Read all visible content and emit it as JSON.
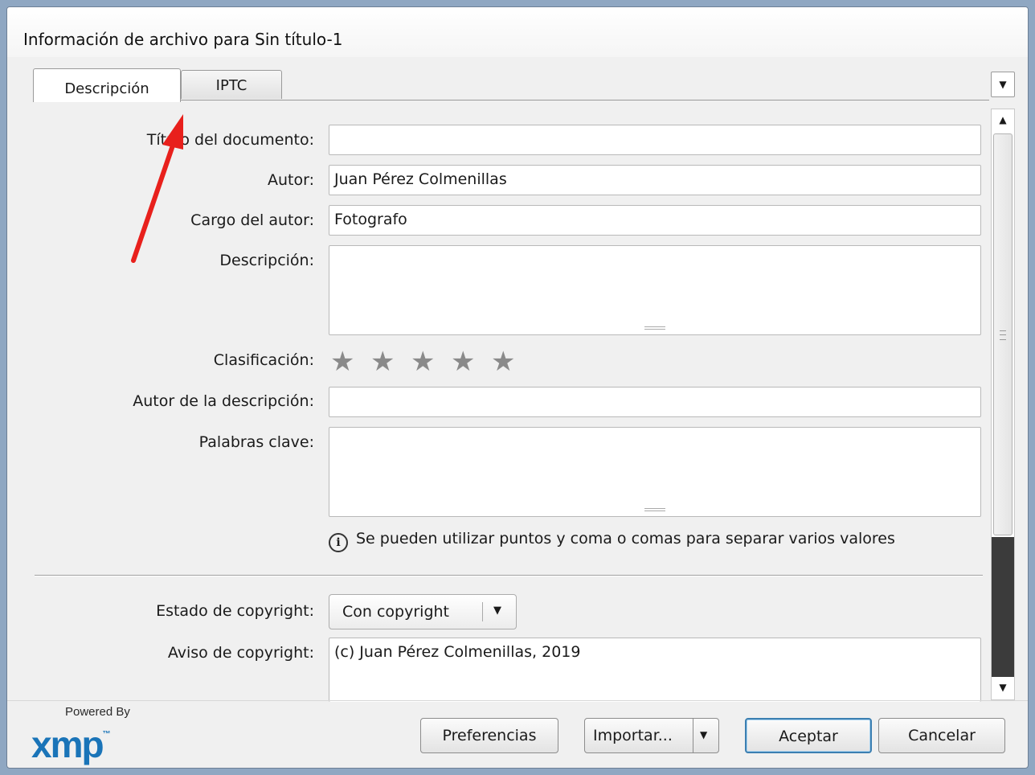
{
  "window": {
    "title": "Información de archivo para Sin título-1"
  },
  "tabs": [
    {
      "label": "Descripción",
      "active": true
    },
    {
      "label": "IPTC",
      "active": false
    }
  ],
  "menu_arrow": "chevron-down-icon",
  "form": {
    "doc_title": {
      "label": "Título del documento:",
      "value": ""
    },
    "author": {
      "label": "Autor:",
      "value": "Juan Pérez Colmenillas"
    },
    "author_title": {
      "label": "Cargo del autor:",
      "value": "Fotografo"
    },
    "description": {
      "label": "Descripción:",
      "value": ""
    },
    "rating": {
      "label": "Clasificación:",
      "stars_total": 5,
      "stars_filled": 0
    },
    "description_writer": {
      "label": "Autor de la descripción:",
      "value": ""
    },
    "keywords": {
      "label": "Palabras clave:",
      "value": ""
    },
    "keywords_hint": "Se pueden utilizar puntos y coma o comas para separar varios valores",
    "copyright_status": {
      "label": "Estado de copyright:",
      "selected": "Con copyright"
    },
    "copyright_notice": {
      "label": "Aviso de copyright:",
      "value": "(c) Juan Pérez Colmenillas, 2019"
    }
  },
  "footer": {
    "logo_powered": "Powered By",
    "logo_mark": "xmp",
    "logo_tm": "™",
    "buttons": {
      "preferences": "Preferencias",
      "import": "Importar...",
      "accept": "Aceptar",
      "cancel": "Cancelar"
    }
  },
  "colors": {
    "annotation_arrow": "#e8201c",
    "logo": "#1a74b8",
    "primary_border": "#3c7fb1"
  }
}
